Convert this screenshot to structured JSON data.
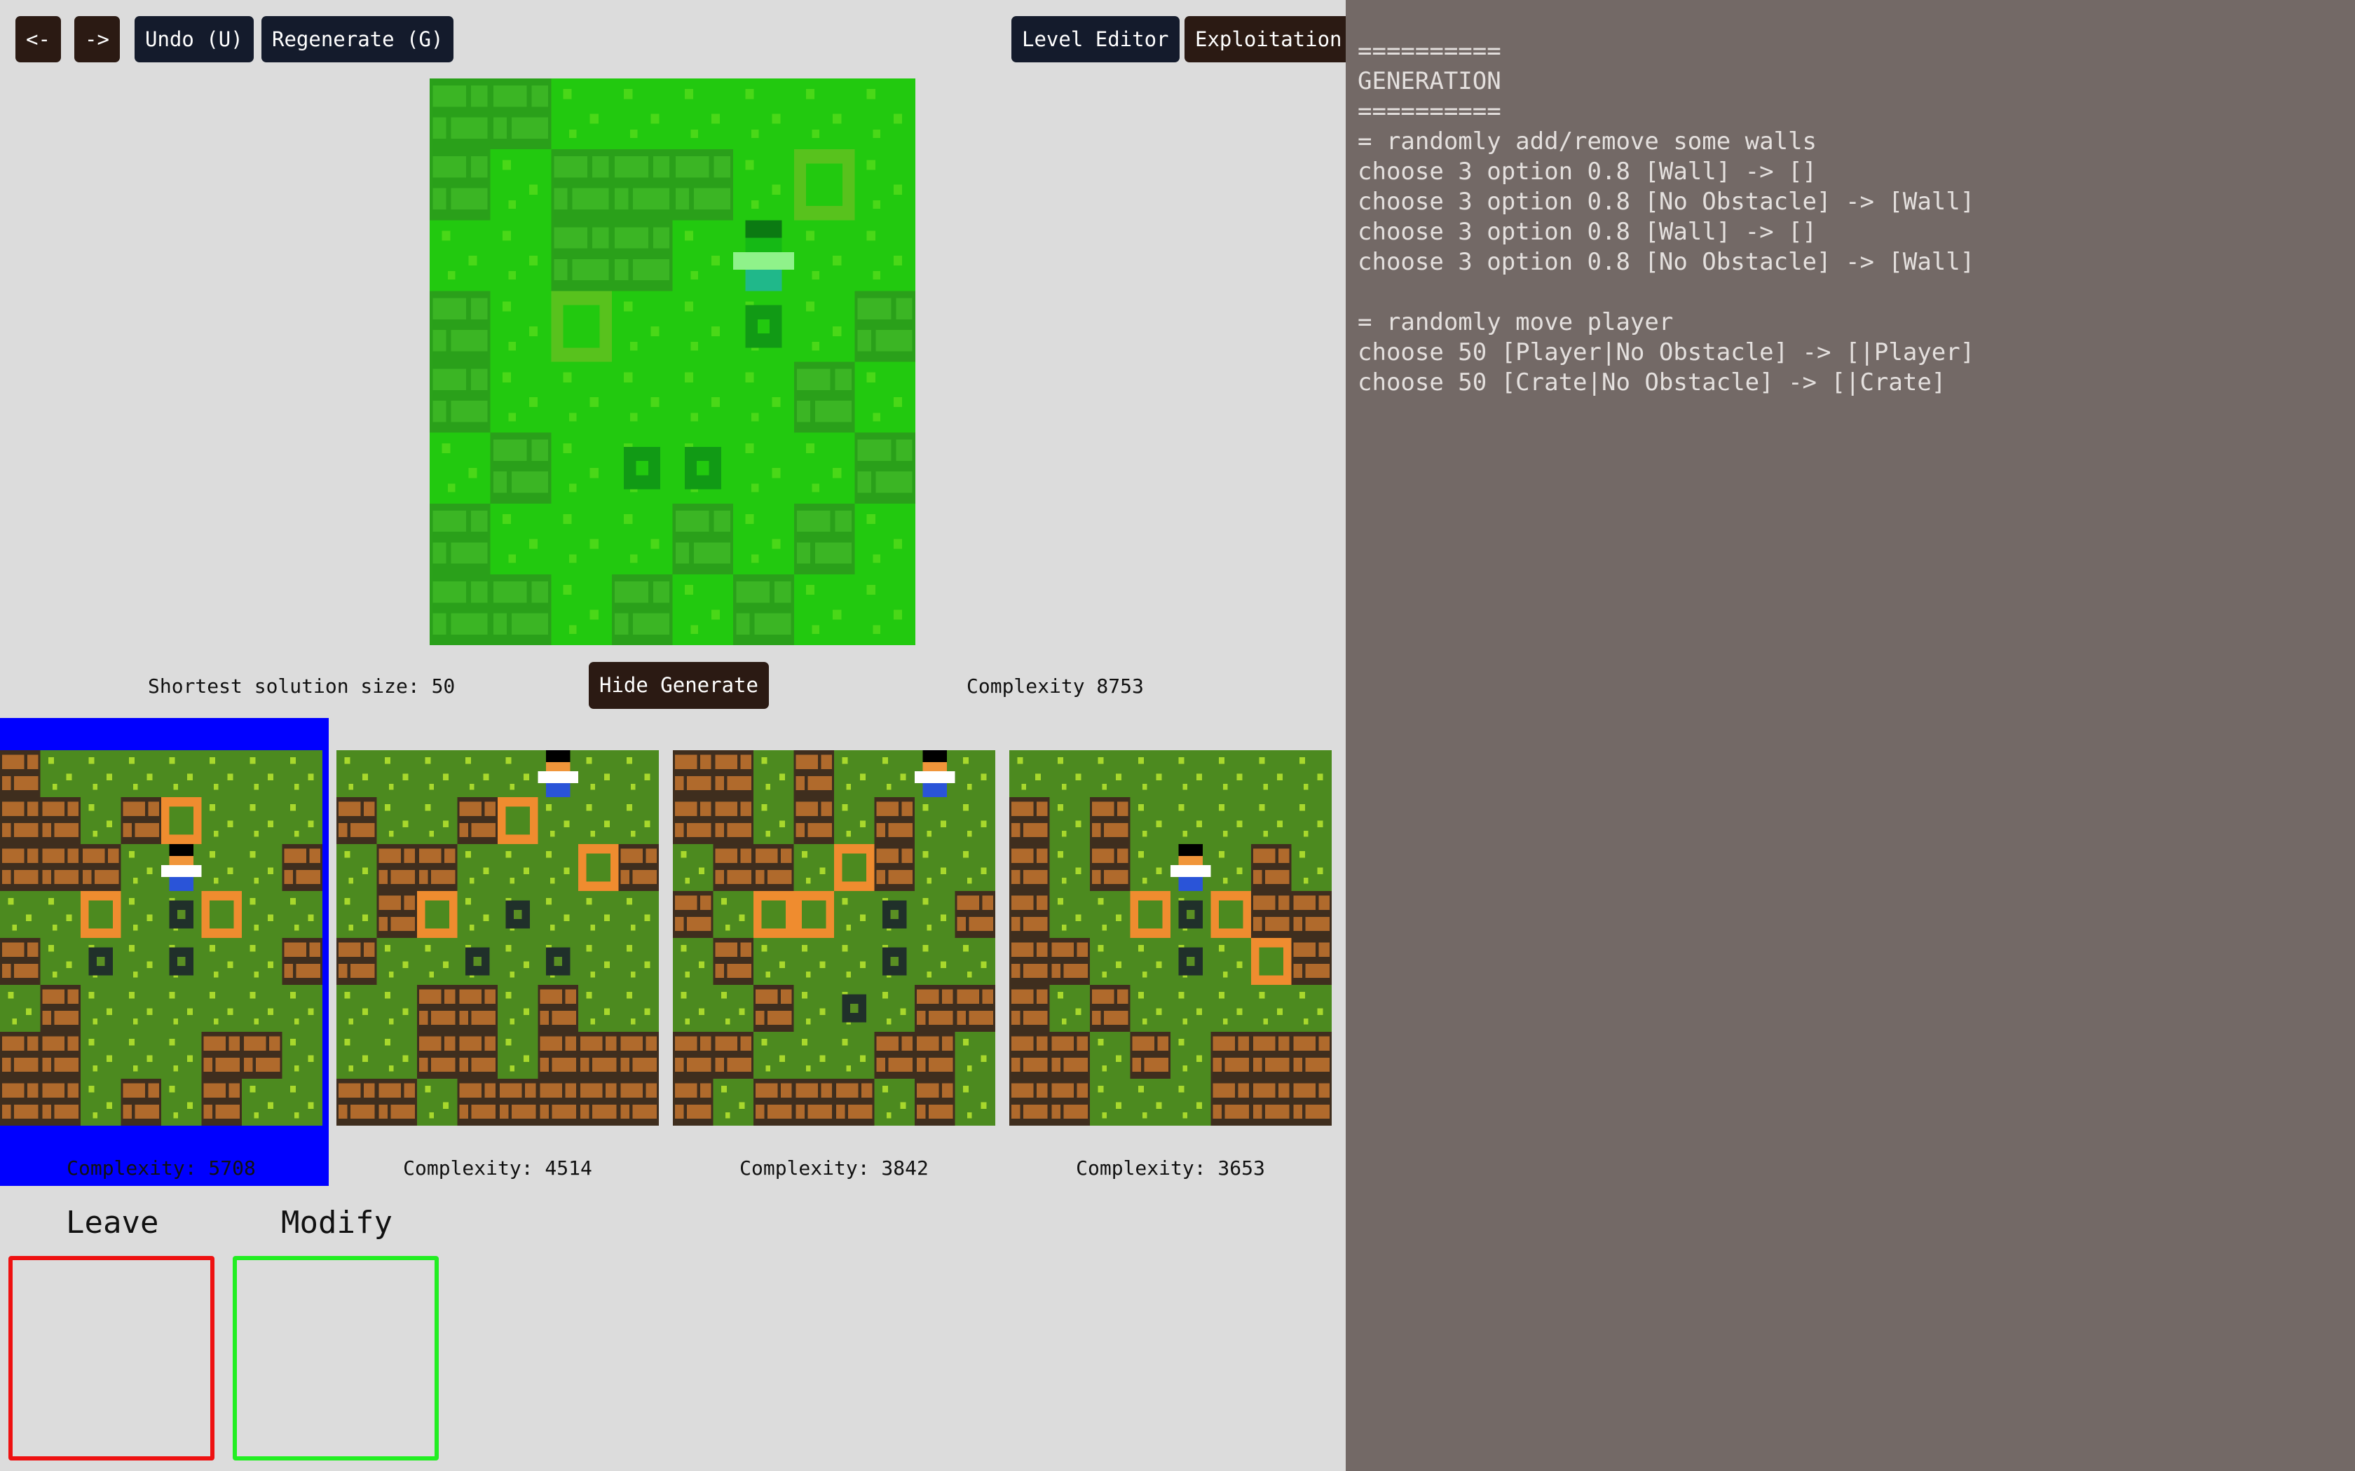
{
  "toolbar": {
    "back_label": "<-",
    "forward_label": "->",
    "undo_label": "Undo (U)",
    "regenerate_label": "Regenerate (G)",
    "level_editor_label": "Level Editor",
    "exploitation_label": "Exploitation"
  },
  "main": {
    "shortest_solution": "Shortest solution size: 50",
    "hide_generate_label": "Hide Generate",
    "complexity": "Complexity 8753"
  },
  "candidates": [
    {
      "complexity": "Complexity: 5708",
      "selected": true
    },
    {
      "complexity": "Complexity: 4514",
      "selected": false
    },
    {
      "complexity": "Complexity: 3842",
      "selected": false
    },
    {
      "complexity": "Complexity: 3653",
      "selected": false
    }
  ],
  "vote": {
    "leave_label": "Leave",
    "modify_label": "Modify",
    "leave_color": "#ee1111",
    "modify_color": "#22ee22"
  },
  "colors": {
    "selection": "#0000ff",
    "log_background": "#736966",
    "main_grass": "#22c90f",
    "thumb_grass": "#4c8a1f",
    "crate": "#ef8c2f"
  },
  "log": {
    "lines": [
      "==========",
      "GENERATION",
      "==========",
      "= randomly add/remove some walls",
      "choose 3 option 0.8 [Wall] -> []",
      "choose 3 option 0.8 [No Obstacle] -> [Wall]",
      "choose 3 option 0.8 [Wall] -> []",
      "choose 3 option 0.8 [No Obstacle] -> [Wall]",
      "",
      "= randomly move player",
      "choose 50 [Player|No Obstacle] -> [|Player]",
      "choose 50 [Crate|No Obstacle] -> [|Crate]"
    ]
  },
  "levels": {
    "main": [
      "WW......",
      "W.WWW.C.",
      "..WW.P..",
      "W.C..T.W",
      "W.....W.",
      ".W.TT..W",
      "W...W.W.",
      "WW.W.W.."
    ],
    "thumbs": [
      [
        "W.......",
        "WW.WC...",
        "WWW.P..W",
        "..C.TC..",
        "W.T.T..W",
        ".W......",
        "WW...WW.",
        "WW.W.W.."
      ],
      [
        ".....P..",
        "W..WC...",
        ".WW...CW",
        ".WC.T...",
        "W..T.T..",
        "..WW.W..",
        "..WW.WWW",
        "WW.WWWWW"
      ],
      [
        "WW.W..P.",
        "WW.W.W..",
        ".WW.CW..",
        "W.CC.T.W",
        ".W...T..",
        "..W.T.WW",
        "WW...WW.",
        "W.WWW.W."
      ],
      [
        "........",
        "W.W.....",
        "W.W.P.W.",
        "W..CTCWW",
        "WW..T.CW",
        "W.W.....",
        "WW.W.WWW",
        "WW...WWW"
      ]
    ]
  }
}
